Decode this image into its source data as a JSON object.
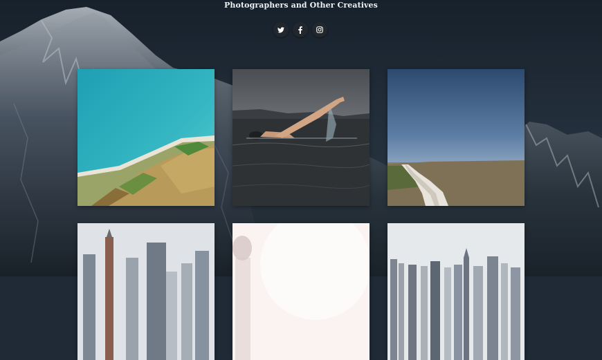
{
  "site": {
    "tagline": "Photographers and Other Creatives"
  },
  "social": [
    {
      "name": "twitter",
      "icon": "twitter-icon"
    },
    {
      "name": "facebook",
      "icon": "facebook-icon"
    },
    {
      "name": "instagram",
      "icon": "instagram-icon"
    }
  ],
  "gallery": [
    {
      "subject": "aerial coastline"
    },
    {
      "subject": "swimmer in dark water"
    },
    {
      "subject": "dirt road through field"
    },
    {
      "subject": "city skyline"
    },
    {
      "subject": "bright figure"
    },
    {
      "subject": "city waterfront skyline"
    }
  ],
  "colors": {
    "background": "#1f2a36",
    "button": "#22272d",
    "text": "#eef1f4"
  }
}
